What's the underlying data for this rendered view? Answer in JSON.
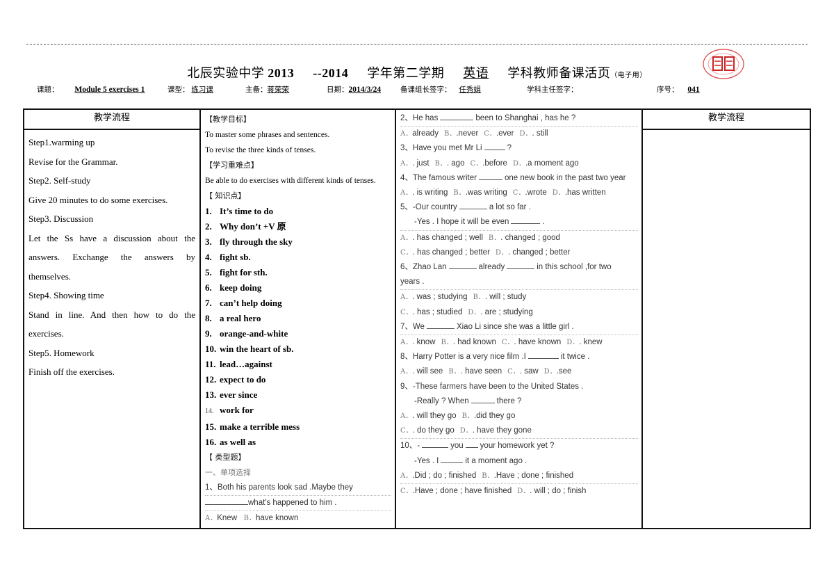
{
  "header": {
    "school": "北辰实验中学",
    "year_start": "2013",
    "year_end": "--2014",
    "term": "学年第二学期",
    "subject": "英语",
    "page_title": "学科教师备课活页",
    "page_note": "（电子用）",
    "seal_icon": "school-seal-icon"
  },
  "info": {
    "topic_label": "课题：",
    "topic_value": "Module 5 exercises 1",
    "type_label": "课型：",
    "type_value": "练习课",
    "lead_label": "主备：",
    "lead_value": "蒋荣荣",
    "date_label": "日期：",
    "date_value": "2014/3/24",
    "group_leader_label": "备课组长签字：",
    "group_leader_value": "任秀娟",
    "director_label": "学科主任签字：",
    "director_value": "",
    "serial_label": "序号：",
    "serial_value": "041"
  },
  "col1": {
    "header": "教学流程",
    "lines": [
      "Step1.warming up",
      "Revise for the Grammar.",
      "Step2. Self-study",
      "Give 20 minutes to do some  exercises.",
      "Step3. Discussion",
      "Let the Ss have a discussion about the",
      "answers. Exchange the answers by",
      "themselves.",
      "Step4. Showing time",
      "Stand in line. And then how to do the",
      "exercises.",
      "Step5. Homework",
      "Finish off the exercises."
    ]
  },
  "col2": {
    "goals_title": "【教学目标】",
    "goals": [
      "To master some phrases and sentences.",
      "To revise the three kinds of tenses."
    ],
    "key_title": "【学习重难点】",
    "key": "Be able to do exercises with different kinds of tenses.",
    "knowledge_title": "【 知识点】",
    "points": [
      {
        "n": "1.",
        "t": "It’s time to do"
      },
      {
        "n": "2.",
        "t": "Why don’t +V 原"
      },
      {
        "n": "3.",
        "t": "fly through the sky"
      },
      {
        "n": "4.",
        "t": "fight sb."
      },
      {
        "n": "5.",
        "t": "fight for sth."
      },
      {
        "n": "6.",
        "t": "keep doing"
      },
      {
        "n": "7.",
        "t": "can’t help doing"
      },
      {
        "n": "8.",
        "t": "a real hero"
      },
      {
        "n": "9.",
        "t": "orange-and-white"
      },
      {
        "n": "10.",
        "t": "win the heart of sb."
      },
      {
        "n": "11.",
        "t": "lead…against"
      },
      {
        "n": "12.",
        "t": "expect to do"
      },
      {
        "n": "13.",
        "t": "ever since"
      },
      {
        "n": "14.",
        "t": "work for"
      },
      {
        "n": "15.",
        "t": "make a terrible mess"
      },
      {
        "n": "16.",
        "t": "as well as"
      }
    ],
    "types_title": "【 类型题】",
    "section1": "一、单项选择",
    "q1_a": "1、Both his parents look sad .Maybe they",
    "q1_b": "what's happened to him .",
    "q1_opt_a": "A．",
    "q1_opt_a_text": "Knew",
    "q1_opt_b": "B．",
    "q1_opt_b_text": "have known"
  },
  "col3": {
    "q2": {
      "pre": "2、He has",
      "post": "been to Shanghai , has he ?"
    },
    "q2_opts": [
      "already",
      ".never",
      ".ever",
      ". still"
    ],
    "q3": {
      "pre": "3、Have you met Mr Li",
      "post": "?"
    },
    "q3_opts": [
      ". just",
      ". ago",
      ".before",
      ".a moment ago"
    ],
    "q4": {
      "pre": "4、The famous writer",
      "post": "one new book in the past two year"
    },
    "q4_opts": [
      ". is writing",
      ".was writing",
      ".wrote",
      ".has written"
    ],
    "q5": {
      "pre": "5、-Our country",
      "post": "a lot so far ."
    },
    "q5_b": {
      "pre": "-Yes . I hope it will be even",
      "post": "."
    },
    "q5_opts_1": [
      ". has changed ; well",
      ". changed ; good"
    ],
    "q5_opts_2": [
      ". has changed ; better",
      ". changed ; better"
    ],
    "q6": {
      "pre": "6、Zhao Lan",
      "mid": "already",
      "post": "in this school ,for two"
    },
    "q6_b": "years .",
    "q6_opts_1": [
      ". was ; studying",
      ". will ; study"
    ],
    "q6_opts_2": [
      ". has ; studied",
      ". are ; studying"
    ],
    "q7": {
      "pre": "7、We",
      "post": "Xiao Li since she was a little girl ."
    },
    "q7_opts": [
      ". know",
      ". had known",
      ". have known",
      ". knew"
    ],
    "q8": {
      "pre": "8、Harry Potter is a very nice film .I",
      "post": "it twice ."
    },
    "q8_opts": [
      ". will see",
      ". have seen",
      ". saw",
      ".see"
    ],
    "q9": "9、-These farmers have been to the United States .",
    "q9_b": {
      "pre": "-Really ? When",
      "post": "there ?"
    },
    "q9_opts_1": [
      ". will they go",
      ".did they go"
    ],
    "q9_opts_2": [
      ". do they go",
      ". have they gone"
    ],
    "q10": {
      "pre": "10、-",
      "mid": "you",
      "post": "your homework yet ?"
    },
    "q10_b": {
      "pre": "-Yes . I",
      "post": "it a moment ago ."
    },
    "q10_opts_1": [
      ".Did ; do ; finished",
      ".Have ; done ; finished"
    ],
    "q10_opts_2": [
      ".Have ; done ; have finished",
      ". will ; do ; finish"
    ],
    "letters": [
      "A",
      "B",
      "C",
      "D"
    ]
  },
  "col4": {
    "header": "教学流程"
  }
}
